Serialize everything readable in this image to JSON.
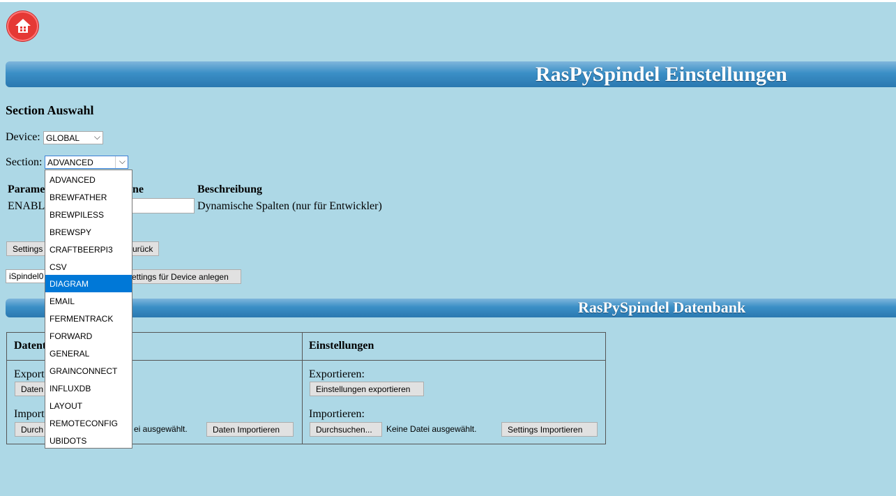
{
  "header": {
    "title": "RasPySpindel Einstellungen",
    "home_icon": "home-icon"
  },
  "section_select": {
    "heading": "Section Auswahl",
    "device_label": "Device:",
    "device_value": "GLOBAL",
    "section_label": "Section:",
    "section_value": "ADVANCED",
    "options": [
      "ADVANCED",
      "BREWFATHER",
      "BREWPILESS",
      "BREWSPY",
      "CRAFTBEERPI3",
      "CSV",
      "DIAGRAM",
      "EMAIL",
      "FERMENTRACK",
      "FORWARD",
      "GENERAL",
      "GRAINCONNECT",
      "INFLUXDB",
      "LAYOUT",
      "REMOTECONFIG",
      "UBIDOTS"
    ],
    "highlighted_option": "DIAGRAM"
  },
  "params_table": {
    "col_parameter": "Parame",
    "col_value": "ne",
    "col_description": "Beschreibung",
    "row_param": "ENABL",
    "row_value": "",
    "row_description": "Dynamische Spalten (nur für Entwickler)"
  },
  "actions": {
    "save_settings": "Settings",
    "reset": "urück",
    "device_input": "iSpindel0",
    "create_device_settings": "ettings für Device anlegen"
  },
  "database": {
    "title": "RasPySpindel Datenbank",
    "left_header": "Datent",
    "left_export_label": "Export",
    "left_export_button": "Daten",
    "left_import_label": "Import",
    "left_browse_button": "Durch",
    "left_no_file": "ei ausgewählt.",
    "left_import_button": "Daten Importieren",
    "right_header": "Einstellungen",
    "right_export_label": "Exportieren:",
    "right_export_button": "Einstellungen exportieren",
    "right_import_label": "Importieren:",
    "right_browse_button": "Durchsuchen...",
    "right_no_file": "Keine Datei ausgewählt.",
    "right_import_button": "Settings Importieren"
  },
  "colors": {
    "background": "#add8e6",
    "banner": "#2a78b0",
    "home_button": "#e53935",
    "highlight": "#0078d7"
  }
}
